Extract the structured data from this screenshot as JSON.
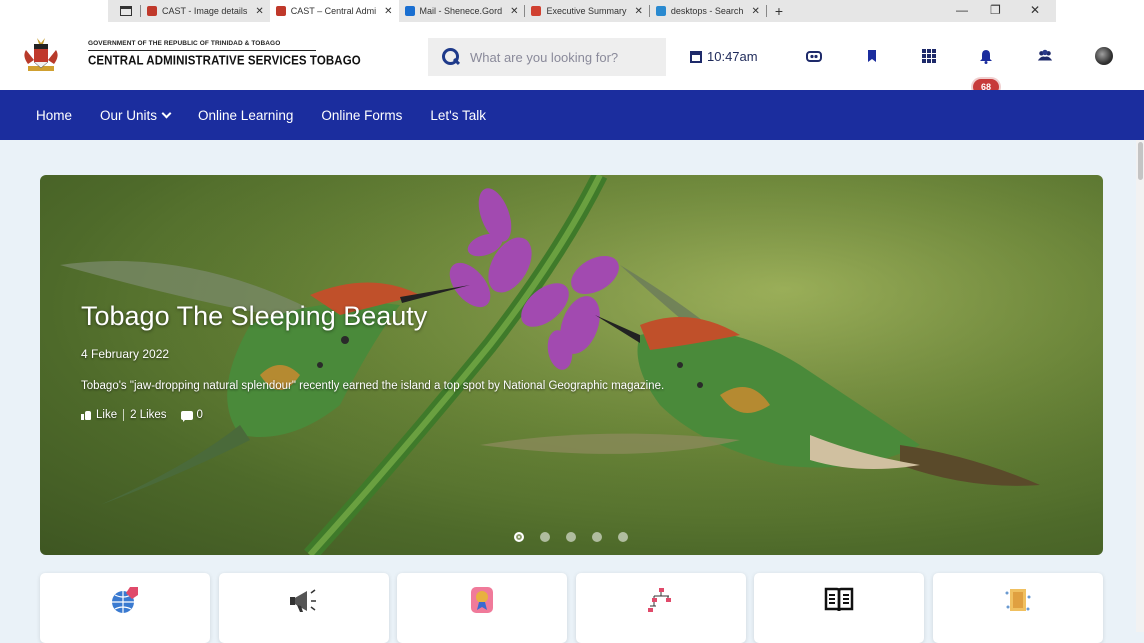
{
  "browser": {
    "tabs": [
      {
        "label": "CAST - Image details",
        "active": false,
        "favicon_color": "#c0392b"
      },
      {
        "label": "CAST – Central Admi",
        "active": true,
        "favicon_color": "#c0392b"
      },
      {
        "label": "Mail - Shenece.Gord",
        "active": false,
        "favicon_color": "#1a6fd1"
      },
      {
        "label": "Executive Summary",
        "active": false,
        "favicon_color": "#d04030"
      },
      {
        "label": "desktops - Search",
        "active": false,
        "favicon_color": "#2a8ad0"
      }
    ],
    "new_tab_glyph": "+",
    "controls": {
      "minimize": "—",
      "restore": "❐",
      "close": "✕"
    }
  },
  "header": {
    "gov_text": "GOVERNMENT OF THE REPUBLIC OF TRINIDAD & TOBAGO",
    "org_text": "CENTRAL ADMINISTRATIVE SERVICES TOBAGO",
    "search_placeholder": "What are you looking for?",
    "time": "10:47am",
    "notification_count": "68",
    "icons": [
      "cc-icon",
      "bookmark-icon",
      "apps-grid-icon",
      "bell-icon",
      "people-icon",
      "avatar"
    ]
  },
  "nav": {
    "items": [
      {
        "label": "Home"
      },
      {
        "label": "Our Units",
        "has_dropdown": true
      },
      {
        "label": "Online Learning"
      },
      {
        "label": "Online Forms"
      },
      {
        "label": "Let's Talk"
      }
    ]
  },
  "hero": {
    "title": "Tobago The Sleeping Beauty",
    "date": "4 February 2022",
    "description": "Tobago's \"jaw-dropping natural splendour\" recently earned the island a top spot by National Geographic magazine.",
    "like_label": "Like",
    "likes_label": "2 Likes",
    "comments_count": "0",
    "slide_count": 5,
    "active_slide": 1
  },
  "cards": [
    {
      "icon": "globe-rocket-icon"
    },
    {
      "icon": "megaphone-icon"
    },
    {
      "icon": "award-icon"
    },
    {
      "icon": "org-chart-icon"
    },
    {
      "icon": "book-icon"
    },
    {
      "icon": "notebook-icon"
    }
  ],
  "colors": {
    "nav_bg": "#1b2d9e",
    "page_bg": "#eaf2f8",
    "badge_bg": "#c73a3a",
    "accent_blue": "#1e3a8a"
  }
}
